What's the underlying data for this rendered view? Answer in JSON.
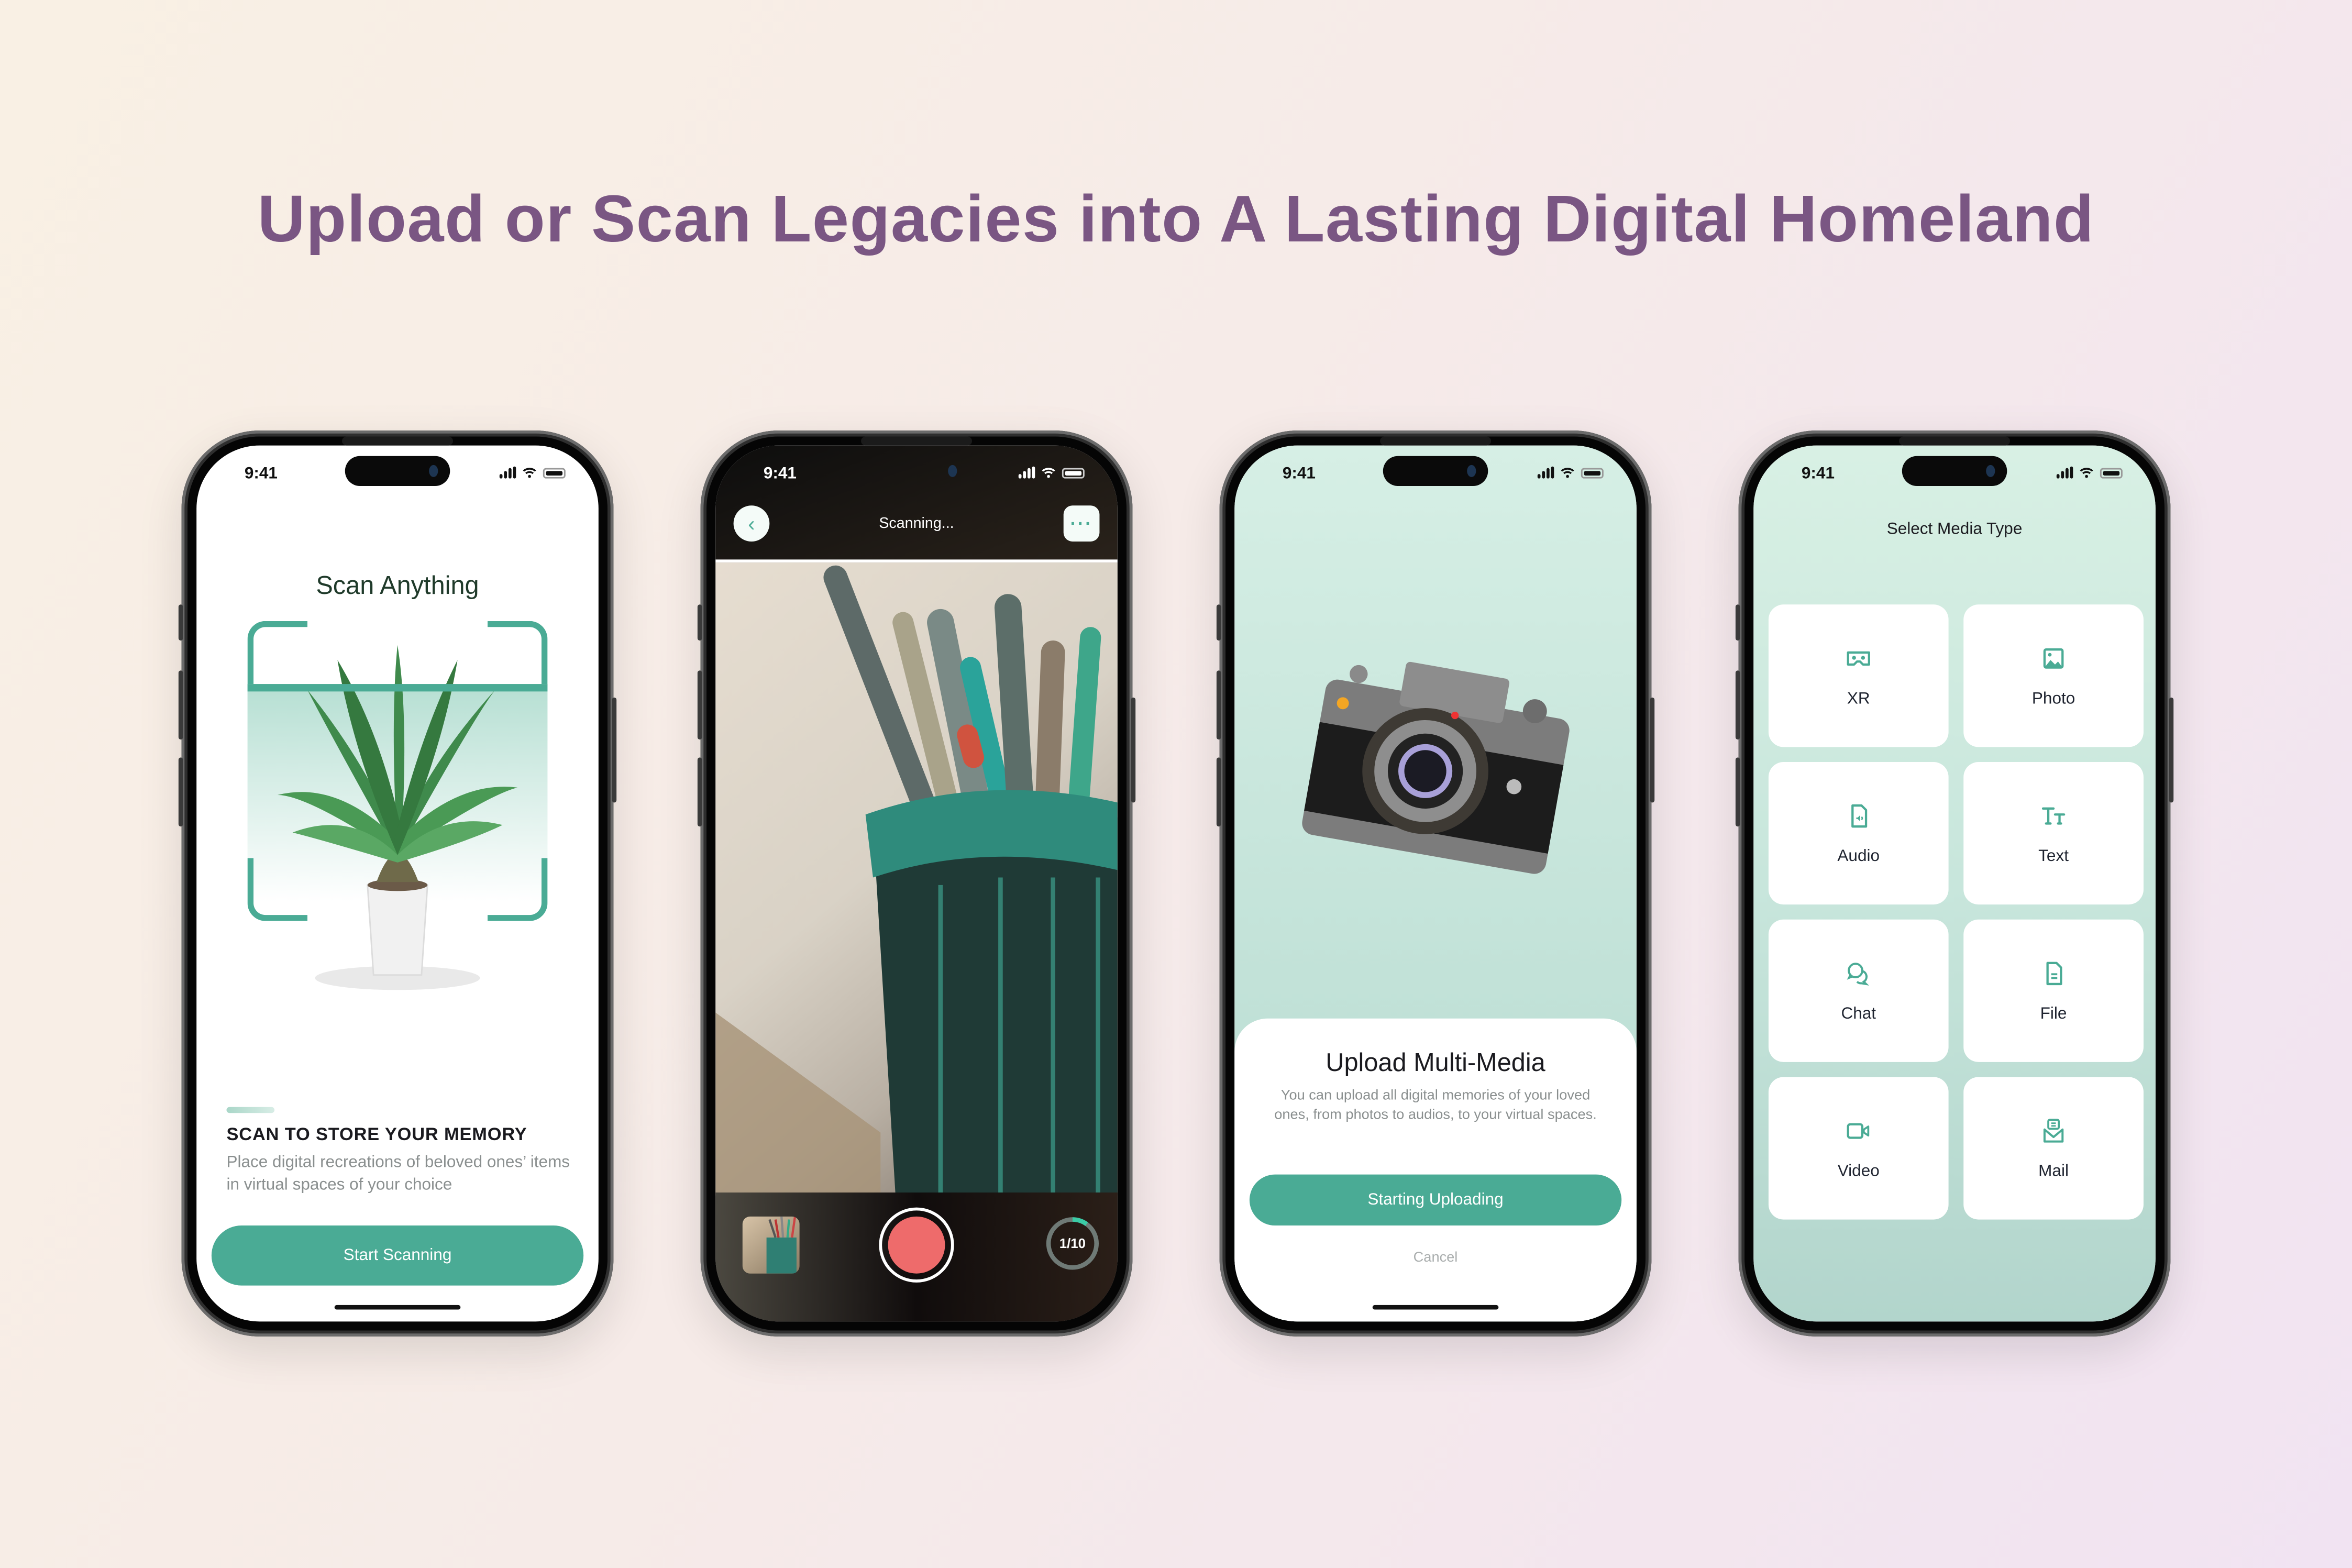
{
  "headline": "Upload or Scan Legacies into A Lasting Digital Homeland",
  "colors": {
    "accent": "#4aab95",
    "headline": "#7a5683",
    "shutter": "#ee6b6b",
    "text_dark": "#1a1a1f",
    "text_muted": "#8a8f8f"
  },
  "status_bar": {
    "time": "9:41"
  },
  "phone1": {
    "title": "Scan Anything",
    "image": "potted-plant",
    "heading": "SCAN TO STORE YOUR MEMORY",
    "description": "Place digital recreations of beloved ones’ items in virtual spaces of your choice",
    "button_label": "Start Scanning"
  },
  "phone2": {
    "title": "Scanning...",
    "back_icon": "chevron-left-icon",
    "more_icon": "more-horizontal-icon",
    "image": "pen-holder-with-pens",
    "counter_label": "1/10",
    "counter_progress": 0.1,
    "shutter_icon": "record-button"
  },
  "phone3": {
    "image": "retro-camera",
    "sheet_title": "Upload Multi-Media",
    "sheet_description": "You can upload all digital memories of your loved ones, from photos to audios, to your virtual spaces.",
    "primary_button": "Starting Uploading",
    "cancel_button": "Cancel"
  },
  "phone4": {
    "title": "Select Media Type",
    "media_types": [
      {
        "label": "XR",
        "icon": "vr-headset-icon"
      },
      {
        "label": "Photo",
        "icon": "image-icon"
      },
      {
        "label": "Audio",
        "icon": "audio-file-icon"
      },
      {
        "label": "Text",
        "icon": "text-size-icon"
      },
      {
        "label": "Chat",
        "icon": "chat-bubbles-icon"
      },
      {
        "label": "File",
        "icon": "file-icon"
      },
      {
        "label": "Video",
        "icon": "video-camera-icon"
      },
      {
        "label": "Mail",
        "icon": "mail-icon"
      }
    ]
  }
}
